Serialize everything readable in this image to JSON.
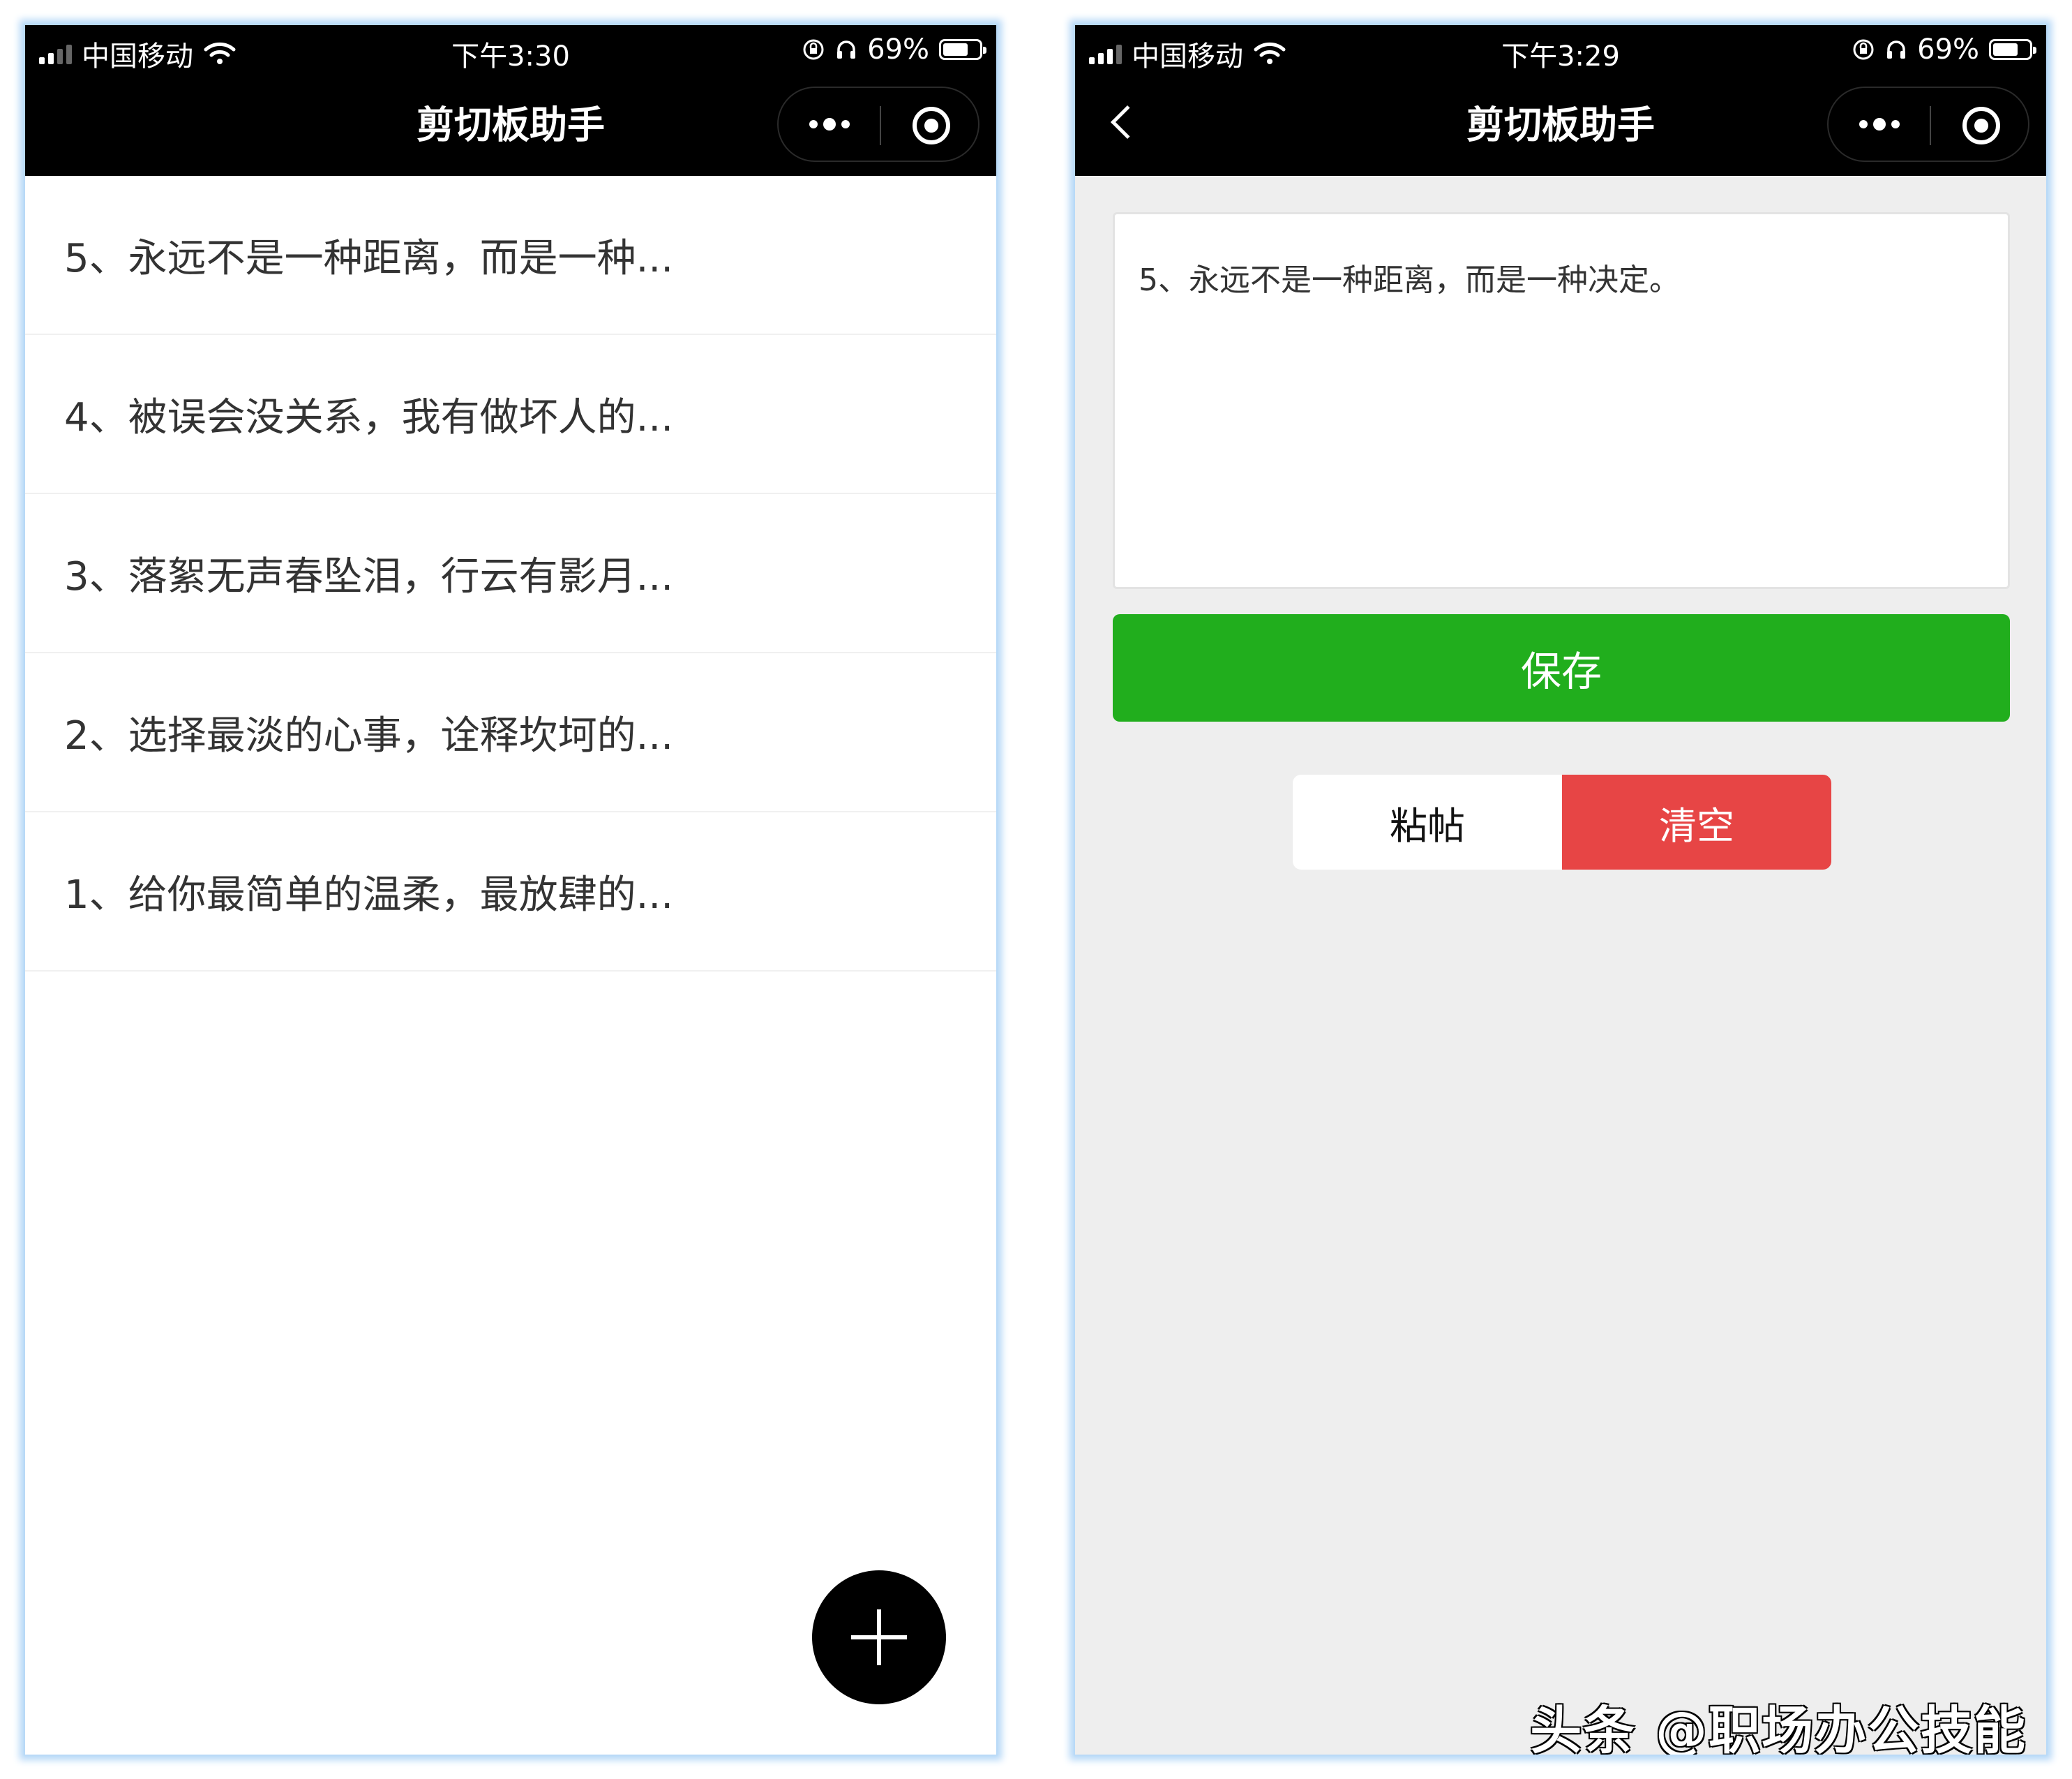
{
  "left_screen": {
    "status": {
      "carrier": "中国移动",
      "time": "下午3:30",
      "battery": "69%"
    },
    "title": "剪切板助手",
    "items": [
      {
        "label": "5、永远不是一种距离，而是一种..."
      },
      {
        "label": "4、被误会没关系，我有做坏人的..."
      },
      {
        "label": "3、落絮无声春坠泪，行云有影月..."
      },
      {
        "label": "2、选择最淡的心事，诠释坎坷的..."
      },
      {
        "label": "1、给你最简单的温柔，最放肆的..."
      }
    ],
    "fab_icon": "plus-icon"
  },
  "right_screen": {
    "status": {
      "carrier": "中国移动",
      "time": "下午3:29",
      "battery": "69%"
    },
    "title": "剪切板助手",
    "textarea_value": "5、永远不是一种距离，而是一种决定。",
    "save_label": "保存",
    "paste_label": "粘帖",
    "clear_label": "清空",
    "watermark": "头条 @职场办公技能"
  },
  "colors": {
    "header": "#000000",
    "save_button": "#21ae1d",
    "clear_button": "#e74545",
    "right_background": "#eeeeee"
  }
}
